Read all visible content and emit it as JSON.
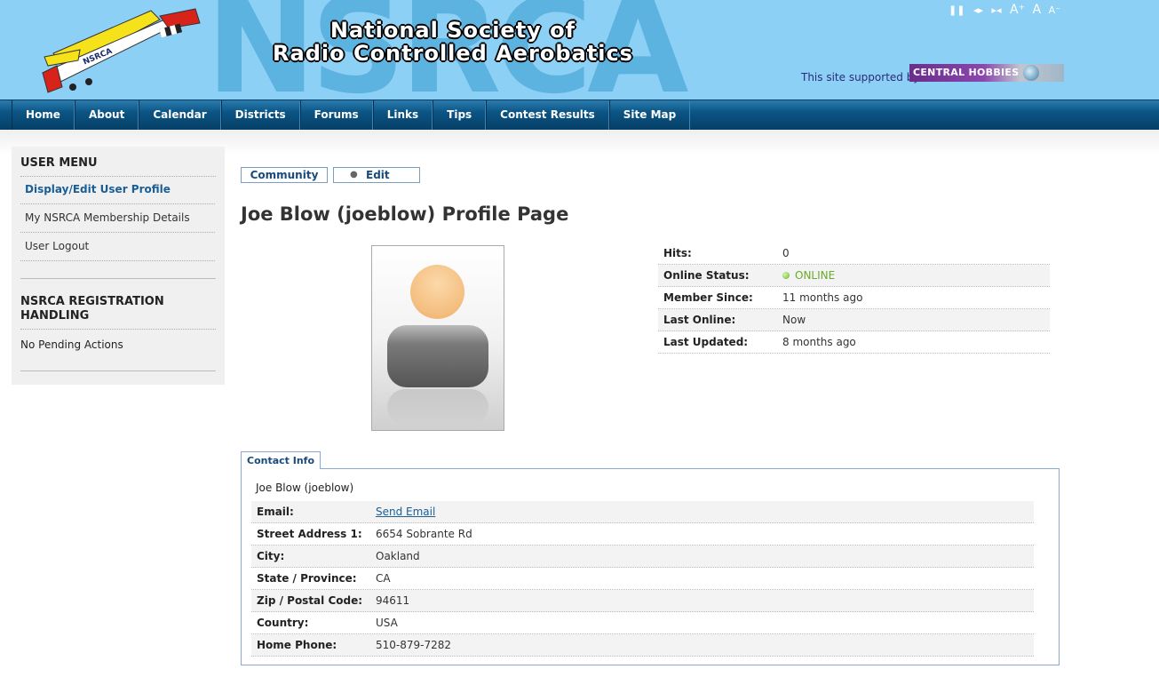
{
  "header": {
    "background_text": "NSRCA",
    "plane_label": "NSRCA",
    "title_line1": "National Society of",
    "title_line2": "Radio Controlled Aerobatics",
    "supported_text": "This site supported by",
    "sponsor_name": "CENTRAL HOBBIES",
    "controls": {
      "pause": "❚❚",
      "prev": "◂▸",
      "next": "▸◂",
      "font_increase": "A⁺",
      "font_reset": "A",
      "font_decrease": "A⁻"
    },
    "colors": {
      "header_bg": "#8dd0f6",
      "nav_bg": "#0b5585"
    }
  },
  "nav": {
    "items": [
      "Home",
      "About",
      "Calendar",
      "Districts",
      "Forums",
      "Links",
      "Tips",
      "Contest Results",
      "Site Map"
    ]
  },
  "sidebar": {
    "user_menu_heading": "USER MENU",
    "user_menu_items": [
      "Display/Edit User Profile",
      "My NSRCA Membership Details",
      "User Logout"
    ],
    "registration_heading": "NSRCA REGISTRATION HANDLING",
    "registration_text": "No Pending Actions"
  },
  "main": {
    "tabs": {
      "community": "Community",
      "edit": "Edit"
    },
    "page_title": "Joe Blow (joeblow) Profile Page",
    "stats": [
      {
        "label": "Hits:",
        "value": "0"
      },
      {
        "label": "Online Status:",
        "value": "ONLINE"
      },
      {
        "label": "Member Since:",
        "value": "11 months ago"
      },
      {
        "label": "Last Online:",
        "value": "Now"
      },
      {
        "label": "Last Updated:",
        "value": "8 months ago"
      }
    ],
    "contact": {
      "tab_label": "Contact Info",
      "name": "Joe Blow (joeblow)",
      "rows": [
        {
          "label": "Email:",
          "value": "Send Email"
        },
        {
          "label": "Street Address 1:",
          "value": "6654 Sobrante Rd"
        },
        {
          "label": "City:",
          "value": "Oakland"
        },
        {
          "label": "State / Province:",
          "value": "CA"
        },
        {
          "label": "Zip / Postal Code:",
          "value": "94611"
        },
        {
          "label": "Country:",
          "value": "USA"
        },
        {
          "label": "Home Phone:",
          "value": "510-879-7282"
        }
      ]
    }
  }
}
